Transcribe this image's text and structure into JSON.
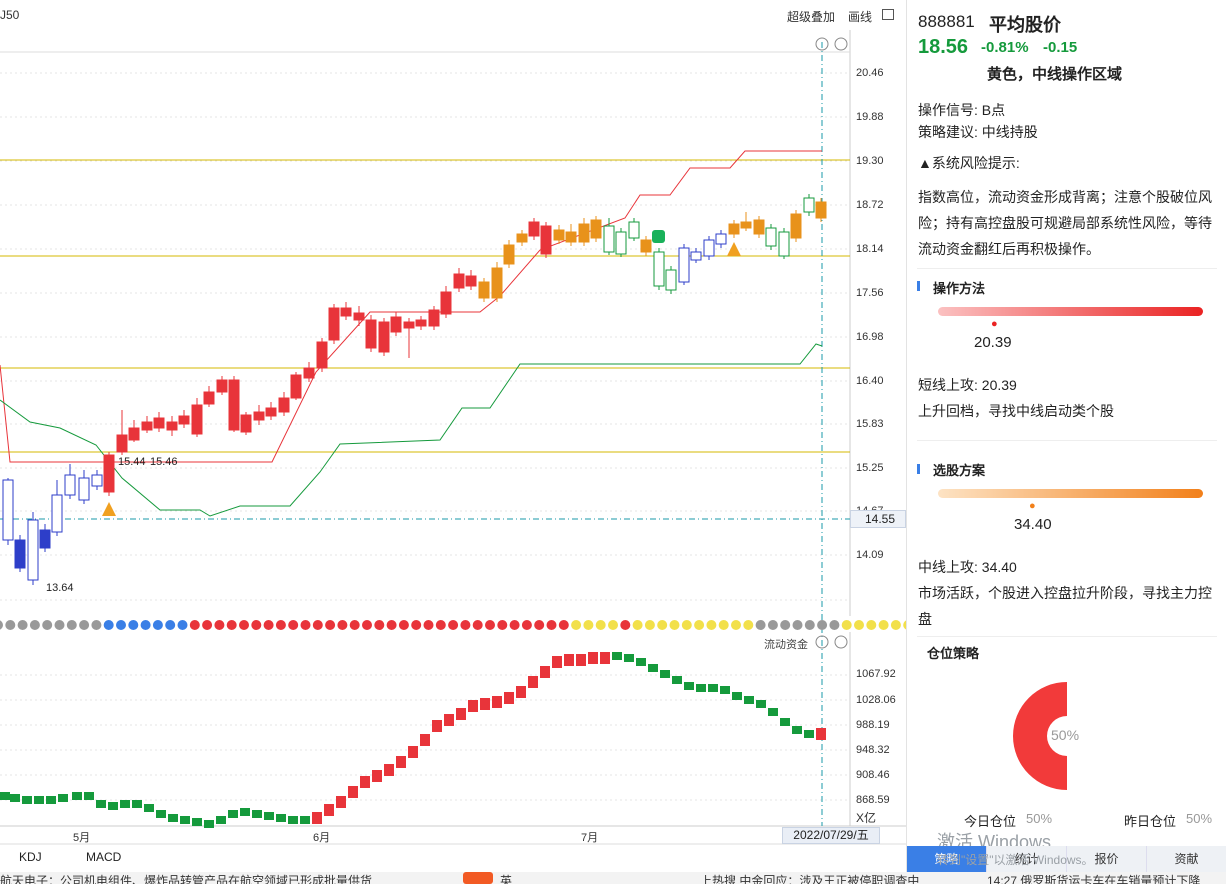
{
  "toolbar": {
    "left_label": "J50",
    "overlay_label": "超级叠加",
    "draw_label": "画线"
  },
  "price_axis": [
    "20.46",
    "19.88",
    "19.30",
    "18.72",
    "18.14",
    "17.56",
    "16.98",
    "16.40",
    "15.83",
    "15.25",
    "14.67",
    "14.09"
  ],
  "current_price_tag": "14.55",
  "price_annotations": {
    "high": "15.44",
    "high2": "15.46",
    "low": "13.64"
  },
  "flow_panel": {
    "title": "流动资金",
    "axis": [
      "1067.92",
      "1028.06",
      "988.19",
      "948.32",
      "908.46",
      "868.59"
    ],
    "unit": "X亿"
  },
  "x_axis": {
    "labels": [
      "5月",
      "6月",
      "7月"
    ],
    "current_date": "2022/07/29/五"
  },
  "indicator_tabs": [
    "KDJ",
    "MACD"
  ],
  "info": {
    "code": "888881",
    "name": "平均股价",
    "price": "18.56",
    "change_pct": "-0.81%",
    "change": "-0.15",
    "zone": "黄色，中线操作区域",
    "signal": "操作信号: B点",
    "advice": "策略建议: 中线持股",
    "risk_title": "▲系统风险提示:",
    "risk_text": "指数高位，流动资金形成背离；注意个股破位风险；持有高控盘股可规避局部系统性风险，等待流动资金翻红后再积极操作。"
  },
  "operation": {
    "title": "操作方法",
    "value": "20.39",
    "line1": "短线上攻: 20.39",
    "line2": "上升回档，寻找中线启动类个股"
  },
  "selection": {
    "title": "选股方案",
    "value": "34.40",
    "line1": "中线上攻: 34.40",
    "line2": "市场活跃，个股进入控盘拉升阶段，寻找主力控盘"
  },
  "position": {
    "title": "仓位策略",
    "center": "50%",
    "today_label": "今日仓位",
    "today_value": "50%",
    "yesterday_label": "昨日仓位",
    "yesterday_value": "50%"
  },
  "bottom_tabs": [
    "策略",
    "统计",
    "报价",
    "资献"
  ],
  "watermark": {
    "line1": "激活 Windows",
    "line2": "转到\"设置\"以激活 Windows。"
  },
  "statusbar": {
    "left": "航天电子：公司机电组件、爆炸品转管产品在航空领域已形成批量供货",
    "ime": "英",
    "mid": "上热搜  中金回应：涉及王正被停职调查中",
    "right": "14:27  俄罗斯货运卡车在车销量预计下降"
  },
  "colors": {
    "up": "#e8343a",
    "down": "#159a3c",
    "orange": "#e8921b",
    "ref": "#d4b800",
    "dash": "#1a9aa8"
  }
}
